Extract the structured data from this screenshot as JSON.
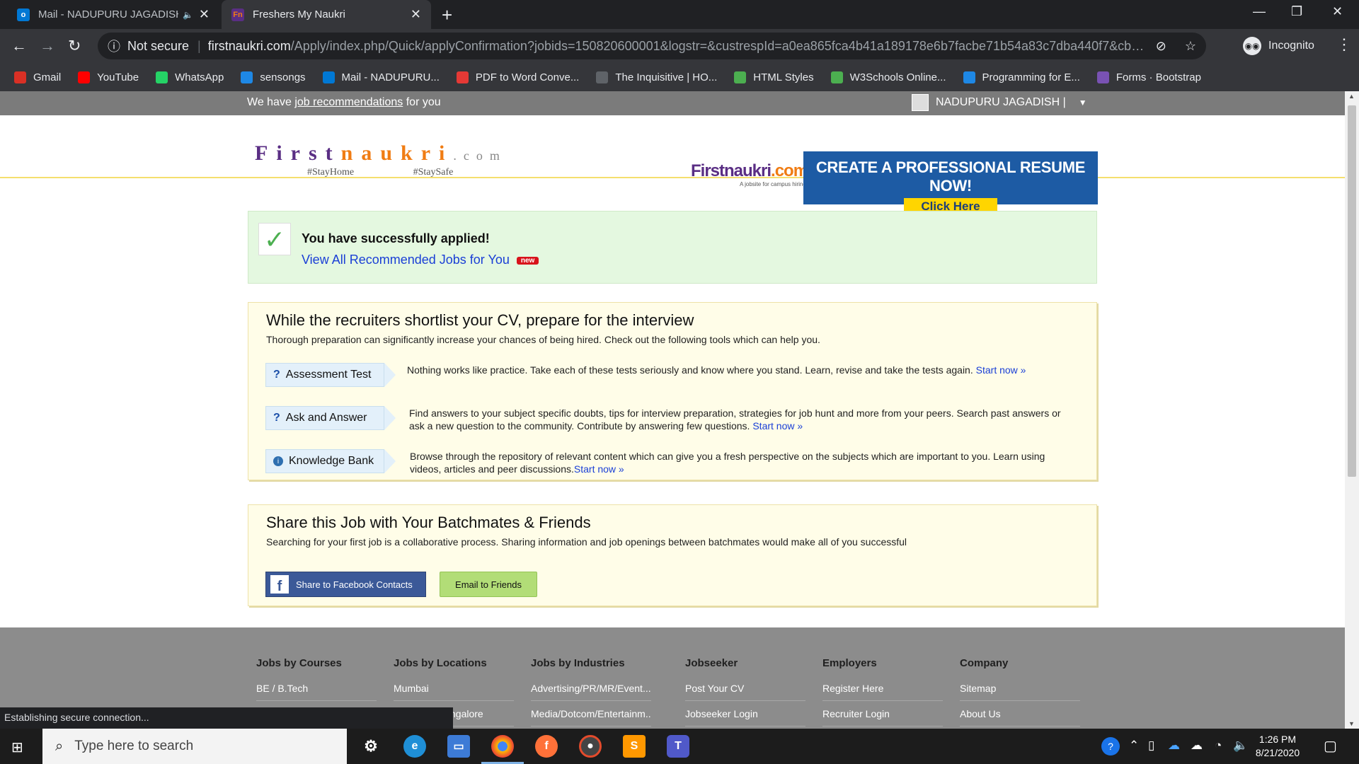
{
  "browser": {
    "tabs": [
      {
        "title": "Mail - NADUPURU JAGADISH",
        "active": false
      },
      {
        "title": "Freshers My Naukri",
        "active": true
      }
    ],
    "security": "Not secure",
    "url_host": "firstnaukri.com",
    "url_path": "/Apply/index.php/Quick/applyConfirmation?jobids=150820600001&logstr=&custrespId=a0ea865fca4b41a189178e6b7facbe71b54a83c7dba440f7&cbData=&te...",
    "profile": "Incognito",
    "bookmarks": [
      {
        "label": "Gmail",
        "icon": "gmail-icon",
        "color": "#d93025"
      },
      {
        "label": "YouTube",
        "icon": "youtube-icon",
        "color": "#ff0000"
      },
      {
        "label": "WhatsApp",
        "icon": "whatsapp-icon",
        "color": "#25d366"
      },
      {
        "label": "sensongs",
        "icon": "sensongs-icon",
        "color": "#1e88e5"
      },
      {
        "label": "Mail - NADUPURU...",
        "icon": "outlook-icon",
        "color": "#0078d4"
      },
      {
        "label": "PDF to Word Conve...",
        "icon": "pdf-icon",
        "color": "#e53935"
      },
      {
        "label": "The Inquisitive | HO...",
        "icon": "globe-icon",
        "color": "#5f6368"
      },
      {
        "label": "HTML Styles",
        "icon": "w3-icon",
        "color": "#4caf50"
      },
      {
        "label": "W3Schools Online...",
        "icon": "w3-icon",
        "color": "#4caf50"
      },
      {
        "label": "Programming for E...",
        "icon": "link-icon",
        "color": "#1e88e5"
      },
      {
        "label": "Forms · Bootstrap",
        "icon": "bootstrap-icon",
        "color": "#7952b3"
      }
    ],
    "status": "Establishing secure connection..."
  },
  "page": {
    "top_prefix": "We have",
    "top_link": "job recommendations",
    "top_suffix": "for you",
    "user_name": "NADUPURU JAGADISH |",
    "logo_first": "First",
    "logo_naukri": "naukri",
    "logo_com": ".com",
    "hashtag1": "#StayHome",
    "hashtag2": "#StaySafe",
    "banner_logo_first": "Firstnaukri",
    "banner_logo_com": ".com",
    "banner_logo_tag": "A jobsite for campus hiring!",
    "banner_heading": "CREATE A PROFESSIONAL RESUME NOW!",
    "banner_cta": "Click Here",
    "success_title": "You have successfully applied!",
    "success_link": "View All Recommended Jobs for You",
    "new_badge": "new",
    "prep_title": "While the recruiters shortlist your CV, prepare for the interview",
    "prep_sub": "Thorough preparation can significantly increase your chances of being hired. Check out the following tools which can help you.",
    "tools": [
      {
        "label": "Assessment Test",
        "desc": "Nothing works like practice. Take each of these tests seriously and know where you stand. Learn, revise and take the tests again.",
        "link": "Start now »"
      },
      {
        "label": "Ask and Answer",
        "desc": "Find answers to your subject specific doubts, tips for interview preparation, strategies for job hunt and more from your peers. Search past answers or ask a new question to the community. Contribute by answering few questions.",
        "link": "Start now »"
      },
      {
        "label": "Knowledge Bank",
        "desc": "Browse through the repository of relevant content which can give you a fresh perspective on the subjects which are important to you. Learn using videos, articles and peer discussions.",
        "link": "Start now »"
      }
    ],
    "share_title": "Share this Job with Your Batchmates & Friends",
    "share_sub": "Searching for your first job is a collaborative process. Sharing information and job openings between batchmates would make all of you successful",
    "fb_button": "Share to Facebook Contacts",
    "email_button": "Email to Friends",
    "footer": [
      {
        "heading": "Jobs by Courses",
        "links": [
          "BE / B.Tech",
          ""
        ]
      },
      {
        "heading": "Jobs by Locations",
        "links": [
          "Mumbai",
          "ngalore"
        ]
      },
      {
        "heading": "Jobs by Industries",
        "links": [
          "Advertising/PR/MR/Event...",
          "Media/Dotcom/Entertainm..."
        ]
      },
      {
        "heading": "Jobseeker",
        "links": [
          "Post Your CV",
          "Jobseeker Login"
        ]
      },
      {
        "heading": "Employers",
        "links": [
          "Register Here",
          "Recruiter Login"
        ]
      },
      {
        "heading": "Company",
        "links": [
          "Sitemap",
          "About Us"
        ]
      }
    ]
  },
  "taskbar": {
    "search_placeholder": "Type here to search",
    "time": "1:26 PM",
    "date": "8/21/2020"
  }
}
